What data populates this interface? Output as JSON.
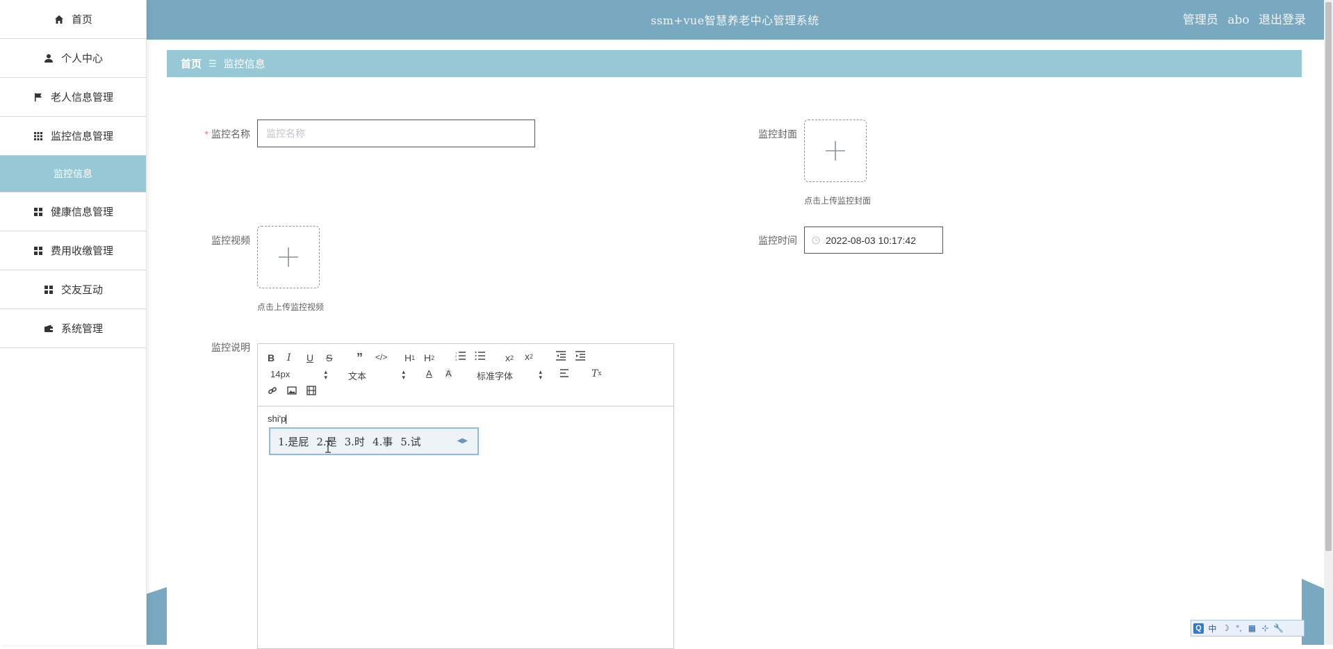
{
  "header": {
    "title": "ssm+vue智慧养老中心管理系统",
    "role": "管理员",
    "username": "abo",
    "logout": "退出登录"
  },
  "sidebar": {
    "items": [
      {
        "label": "首页",
        "icon": "home-icon"
      },
      {
        "label": "个人中心",
        "icon": "user-icon"
      },
      {
        "label": "老人信息管理",
        "icon": "flag-icon"
      },
      {
        "label": "监控信息管理",
        "icon": "grid-icon"
      },
      {
        "label": "监控信息",
        "icon": "",
        "active": true
      },
      {
        "label": "健康信息管理",
        "icon": "apps-icon"
      },
      {
        "label": "费用收缴管理",
        "icon": "apps-icon"
      },
      {
        "label": "交友互动",
        "icon": "apps-icon"
      },
      {
        "label": "系统管理",
        "icon": "wallet-icon"
      }
    ]
  },
  "breadcrumb": {
    "home": "首页",
    "separator": "☰",
    "current": "监控信息"
  },
  "form": {
    "name_label": "监控名称",
    "name_placeholder": "监控名称",
    "name_value": "",
    "cover_label": "监控封面",
    "cover_tip": "点击上传监控封面",
    "video_label": "监控视频",
    "video_tip": "点击上传监控视频",
    "time_label": "监控时间",
    "time_value": "2022-08-03 10:17:42",
    "desc_label": "监控说明"
  },
  "editor": {
    "size_select": "14px",
    "type_select": "文本",
    "font_select": "标准字体",
    "content": "shi'p",
    "toolbar_icons": [
      "bold-icon",
      "italic-icon",
      "underline-icon",
      "strike-icon",
      "quote-icon",
      "code-icon",
      "h1-icon",
      "h2-icon",
      "ordered-list-icon",
      "bullet-list-icon",
      "subscript-icon",
      "superscript-icon",
      "outdent-icon",
      "indent-icon",
      "font-color-icon",
      "background-color-icon",
      "align-icon",
      "clear-format-icon",
      "link-icon",
      "image-icon",
      "video-icon"
    ]
  },
  "ime": {
    "candidates": [
      "1.是屁",
      "2.是",
      "3.时",
      "4.事",
      "5.试"
    ],
    "status_items": [
      "中",
      "☽",
      "°,",
      "▦",
      "⊹",
      "🔧"
    ]
  },
  "colors": {
    "header_bg": "#78a9c1",
    "accent": "#97c8d6",
    "required": "#f56c6c"
  }
}
